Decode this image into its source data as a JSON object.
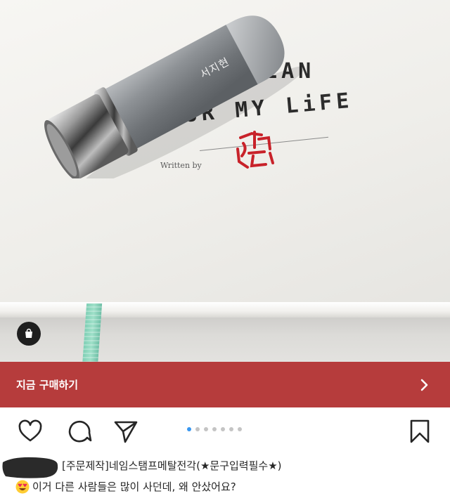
{
  "photo": {
    "engraved_name": "서지현",
    "book_title_line1": "PLAN",
    "book_title_line2": "UR MY LiFE",
    "written_by": "Written by",
    "seal_text": "지현"
  },
  "buy_bar": {
    "label": "지금 구매하기",
    "background": "#b63c3c"
  },
  "actions": {
    "icons": [
      "heart-icon",
      "comment-icon",
      "send-icon",
      "bookmark-icon"
    ],
    "carousel": {
      "count": 7,
      "active": 0
    },
    "accent": "#3897f0"
  },
  "caption": {
    "product_name": "[주문제작]네임스탬프메탈전각(★문구입력필수★)",
    "comment_emoji": "heart-eyes-emoji",
    "comment": "이거 다른 사람들은 많이 사던데, 왜 안샀어요?"
  }
}
